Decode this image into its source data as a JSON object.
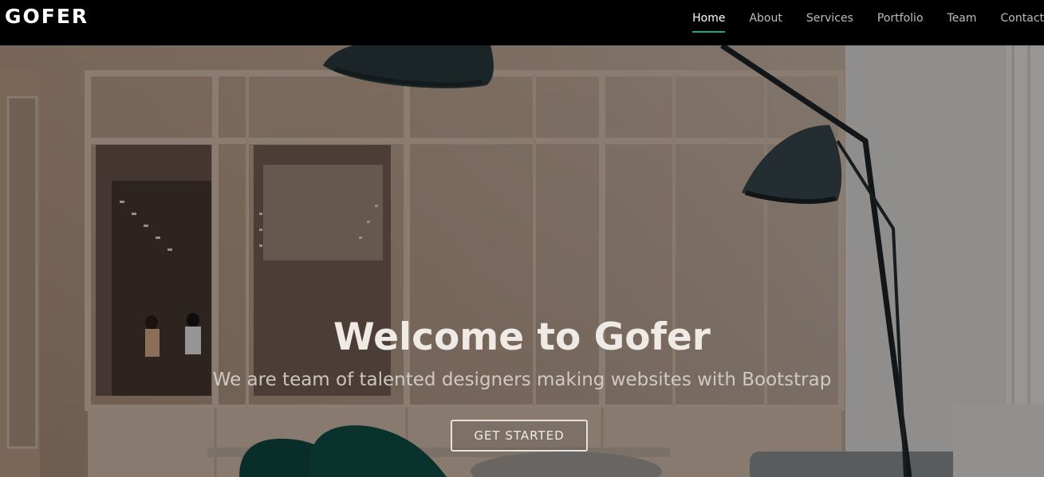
{
  "brand": {
    "name": "GOFER"
  },
  "nav": {
    "items": [
      {
        "label": "Home",
        "active": true
      },
      {
        "label": "About",
        "active": false
      },
      {
        "label": "Services",
        "active": false
      },
      {
        "label": "Portfolio",
        "active": false
      },
      {
        "label": "Team",
        "active": false
      },
      {
        "label": "Contact",
        "active": false
      }
    ],
    "active_color": "#18a98a"
  },
  "hero": {
    "title": "Welcome to Gofer",
    "subtitle": "We are team of talented designers making websites with Bootstrap",
    "cta_label": "GET STARTED",
    "background": "office-interior-photo"
  }
}
